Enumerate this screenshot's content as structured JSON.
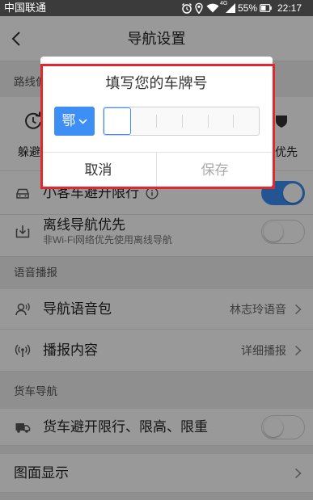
{
  "colors": {
    "accent": "#3d8ef5",
    "highlight_frame": "#e5262d"
  },
  "status_bar": {
    "carrier": "中国联通",
    "network_type": "4G",
    "battery": "55%",
    "time": "22:17",
    "icons": [
      "alarm-icon",
      "location-icon",
      "wifi-icon",
      "signal-icon",
      "battery-icon"
    ]
  },
  "header": {
    "back_icon": "back-arrow-icon",
    "title": "导航设置"
  },
  "route_section": {
    "label": "路线偏",
    "options": [
      {
        "label": "躲避",
        "icon": "loop-arrow-icon"
      },
      {
        "label": "优先",
        "icon": "shield-icon"
      }
    ]
  },
  "rows": {
    "car_restriction": {
      "label": "小客车避开限行",
      "icon": "car-icon",
      "info_icon": "info-icon",
      "toggle_on": true
    },
    "offline_first": {
      "label": "离线导航优先",
      "sublabel": "非Wi-Fi网络优先使用离线导航",
      "icon": "offline-download-icon",
      "toggle_on": false
    }
  },
  "voice_section": {
    "label": "语音播报",
    "items": [
      {
        "label": "导航语音包",
        "value": "林志玲语音",
        "icon": "voice-pack-icon",
        "chevron_icon": "chevron-right-icon"
      },
      {
        "label": "播报内容",
        "value": "详细播报",
        "icon": "broadcast-icon",
        "chevron_icon": "chevron-right-icon"
      }
    ]
  },
  "truck_section": {
    "label": "货车导航",
    "items": [
      {
        "label": "货车避开限行、限高、限重",
        "icon": "truck-icon",
        "toggle_on": false
      }
    ]
  },
  "map_display": {
    "label": "图面显示",
    "chevron_icon": "chevron-right-icon"
  },
  "dialog": {
    "title": "填写您的车牌号",
    "province": "鄂",
    "province_chevron_icon": "chevron-down-icon",
    "cancel_label": "取消",
    "save_label": "保存",
    "save_enabled": false
  }
}
